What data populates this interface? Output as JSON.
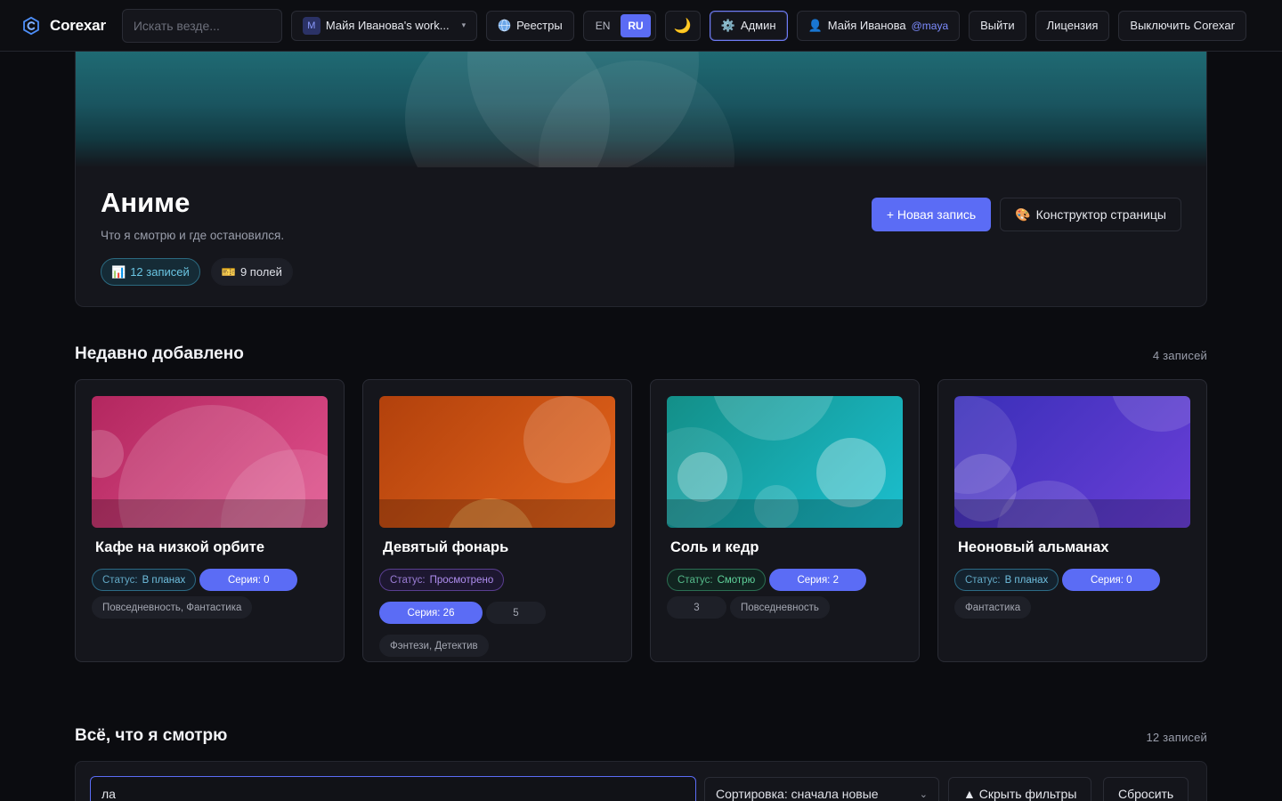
{
  "topbar": {
    "brand": "Corexar",
    "search_placeholder": "Искать везде...",
    "workspace_initial": "M",
    "workspace_name": "Майя Иванова's work...",
    "registries_label": "Реестры",
    "lang_en": "EN",
    "lang_ru": "RU",
    "active_lang": "RU",
    "theme_icon": "🌙",
    "admin_label": "Админ",
    "user_name": "Майя Иванова",
    "user_handle": "@maya",
    "logout_label": "Выйти",
    "license_label": "Лицензия",
    "disable_label": "Выключить Corexar"
  },
  "hero": {
    "title": "Аниме",
    "subtitle": "Что я смотрю и где остановился.",
    "records_chip": "12 записей",
    "fields_chip": "9 полей",
    "new_record_label": "+ Новая запись",
    "page_builder_label": "Конструктор страницы"
  },
  "recent": {
    "title": "Недавно добавлено",
    "count": "4 записей",
    "cards": [
      {
        "title": "Кафе на низкой орбите",
        "status_key": "Статус:",
        "status_value": "В планах",
        "status_tone": "blue",
        "series_label": "Серия: 0",
        "extra_number": "",
        "genres": "Повседневность, Фантастика",
        "colors": {
          "from": "#b3275f",
          "to": "#e0508c"
        }
      },
      {
        "title": "Девятый фонарь",
        "status_key": "Статус:",
        "status_value": "Просмотрено",
        "status_tone": "purple",
        "series_label": "Серия: 26",
        "extra_number": "5",
        "genres": "Фэнтези, Детектив",
        "colors": {
          "from": "#b2410c",
          "to": "#e5651c"
        }
      },
      {
        "title": "Соль и кедр",
        "status_key": "Статус:",
        "status_value": "Смотрю",
        "status_tone": "green",
        "series_label": "Серия: 2",
        "extra_number": "3",
        "genres": "Повседневность",
        "colors": {
          "from": "#138f88",
          "to": "#1bbfcf"
        }
      },
      {
        "title": "Неоновый альманах",
        "status_key": "Статус:",
        "status_value": "В планах",
        "status_tone": "blue",
        "series_label": "Серия: 0",
        "extra_number": "",
        "genres": "Фантастика",
        "colors": {
          "from": "#3a2fb8",
          "to": "#6a3fd8"
        }
      }
    ]
  },
  "all": {
    "title": "Всё, что я смотрю",
    "count": "12 записей",
    "filter_value": "ла",
    "sort_label": "Сортировка: сначала новые",
    "hide_filters_label": "▲ Скрыть фильтры",
    "reset_label": "Сбросить"
  },
  "icons": {
    "brand": "corexar-logo-icon",
    "registries": "globe-icon",
    "theme": "moon-icon",
    "admin": "gear-icon",
    "user": "user-icon",
    "records": "bar-chart-icon",
    "fields": "ticket-icon",
    "page_builder": "palette-icon"
  }
}
